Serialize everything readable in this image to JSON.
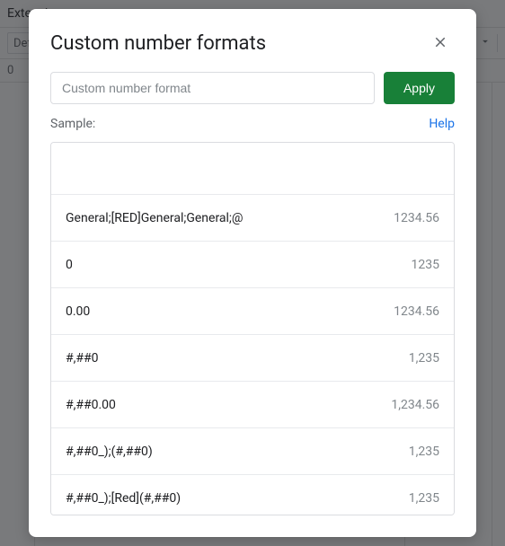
{
  "background": {
    "menu_item": "Extensions",
    "font_field": "Default (Arial)",
    "fx_value": "0"
  },
  "dialog": {
    "title": "Custom number formats",
    "input_placeholder": "Custom number format",
    "apply_label": "Apply",
    "sample_label": "Sample:",
    "help_label": "Help",
    "formats": [
      {
        "code": "General;[RED]General;General;@",
        "sample": "1234.56"
      },
      {
        "code": "0",
        "sample": "1235"
      },
      {
        "code": "0.00",
        "sample": "1234.56"
      },
      {
        "code": "#,##0",
        "sample": "1,235"
      },
      {
        "code": "#,##0.00",
        "sample": "1,234.56"
      },
      {
        "code": "#,##0_);(#,##0)",
        "sample": "1,235"
      },
      {
        "code": "#,##0_);[Red](#,##0)",
        "sample": "1,235"
      }
    ]
  }
}
